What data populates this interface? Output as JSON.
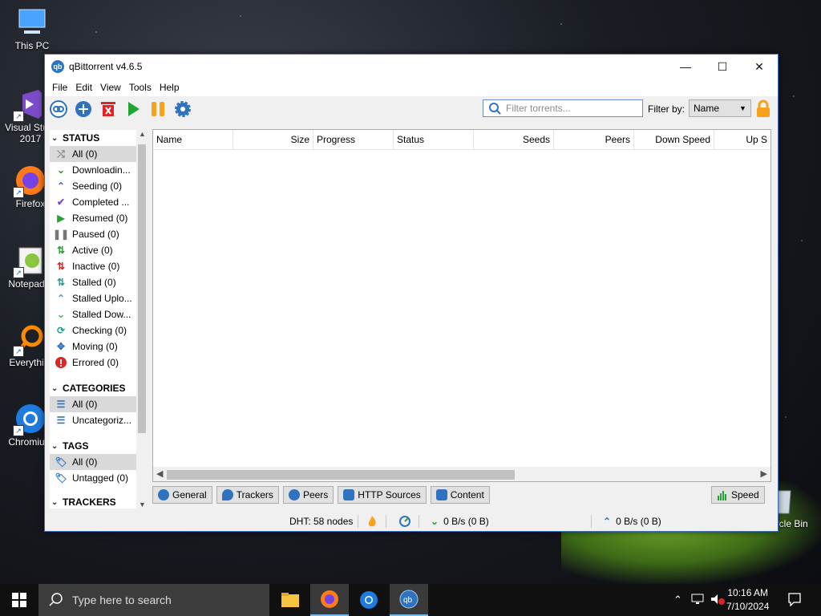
{
  "desktop": {
    "icons": [
      {
        "label": "This PC"
      },
      {
        "label": "Visual Stu...\n2017"
      },
      {
        "label": "Firefox"
      },
      {
        "label": "Notepad..."
      },
      {
        "label": "Everythi..."
      },
      {
        "label": "Chromiu..."
      },
      {
        "label": "Recycle Bin"
      }
    ]
  },
  "window": {
    "title": "qBittorrent v4.6.5",
    "controls": {
      "minimize": "—",
      "maximize": "☐",
      "close": "✕"
    }
  },
  "menu": [
    "File",
    "Edit",
    "View",
    "Tools",
    "Help"
  ],
  "toolbar": {
    "buttons": [
      "add-link",
      "add-torrent",
      "remove",
      "resume",
      "pause",
      "options"
    ],
    "filter_placeholder": "Filter torrents...",
    "filter_by_label": "Filter by:",
    "filter_by_value": "Name"
  },
  "sidebar": {
    "status_header": "STATUS",
    "status_items": [
      {
        "label": "All (0)",
        "icon": "shuffle-icon",
        "selected": true
      },
      {
        "label": "Downloadin...",
        "icon": "download-chevrons-icon"
      },
      {
        "label": "Seeding (0)",
        "icon": "upload-chevrons-icon"
      },
      {
        "label": "Completed ...",
        "icon": "check-icon"
      },
      {
        "label": "Resumed (0)",
        "icon": "play-icon"
      },
      {
        "label": "Paused (0)",
        "icon": "pause-icon"
      },
      {
        "label": "Active (0)",
        "icon": "updown-green-icon"
      },
      {
        "label": "Inactive (0)",
        "icon": "updown-red-icon"
      },
      {
        "label": "Stalled (0)",
        "icon": "updown-teal-icon"
      },
      {
        "label": "Stalled Uplo...",
        "icon": "stalled-upload-icon"
      },
      {
        "label": "Stalled Dow...",
        "icon": "stalled-download-icon"
      },
      {
        "label": "Checking (0)",
        "icon": "refresh-icon"
      },
      {
        "label": "Moving (0)",
        "icon": "move-icon"
      },
      {
        "label": "Errored (0)",
        "icon": "error-icon"
      }
    ],
    "categories_header": "CATEGORIES",
    "category_items": [
      {
        "label": "All (0)",
        "selected": true
      },
      {
        "label": "Uncategoriz..."
      }
    ],
    "tags_header": "TAGS",
    "tag_items": [
      {
        "label": "All (0)",
        "selected": true
      },
      {
        "label": "Untagged (0)"
      }
    ],
    "trackers_header": "TRACKERS"
  },
  "transfer_list": {
    "columns": [
      "Name",
      "Size",
      "Progress",
      "Status",
      "Seeds",
      "Peers",
      "Down Speed",
      "Up S"
    ]
  },
  "properties_tabs": [
    "General",
    "Trackers",
    "Peers",
    "HTTP Sources",
    "Content"
  ],
  "speed_tab": "Speed",
  "statusbar": {
    "dht": "DHT: 58 nodes",
    "download": "0 B/s (0 B)",
    "upload": "0 B/s (0 B)"
  },
  "taskbar": {
    "search_placeholder": "Type here to search",
    "time": "10:16 AM",
    "date": "7/10/2024"
  },
  "colors": {
    "accent": "#2f73c0",
    "green": "#22a334",
    "orange": "#f7a21b",
    "red": "#e02424"
  }
}
